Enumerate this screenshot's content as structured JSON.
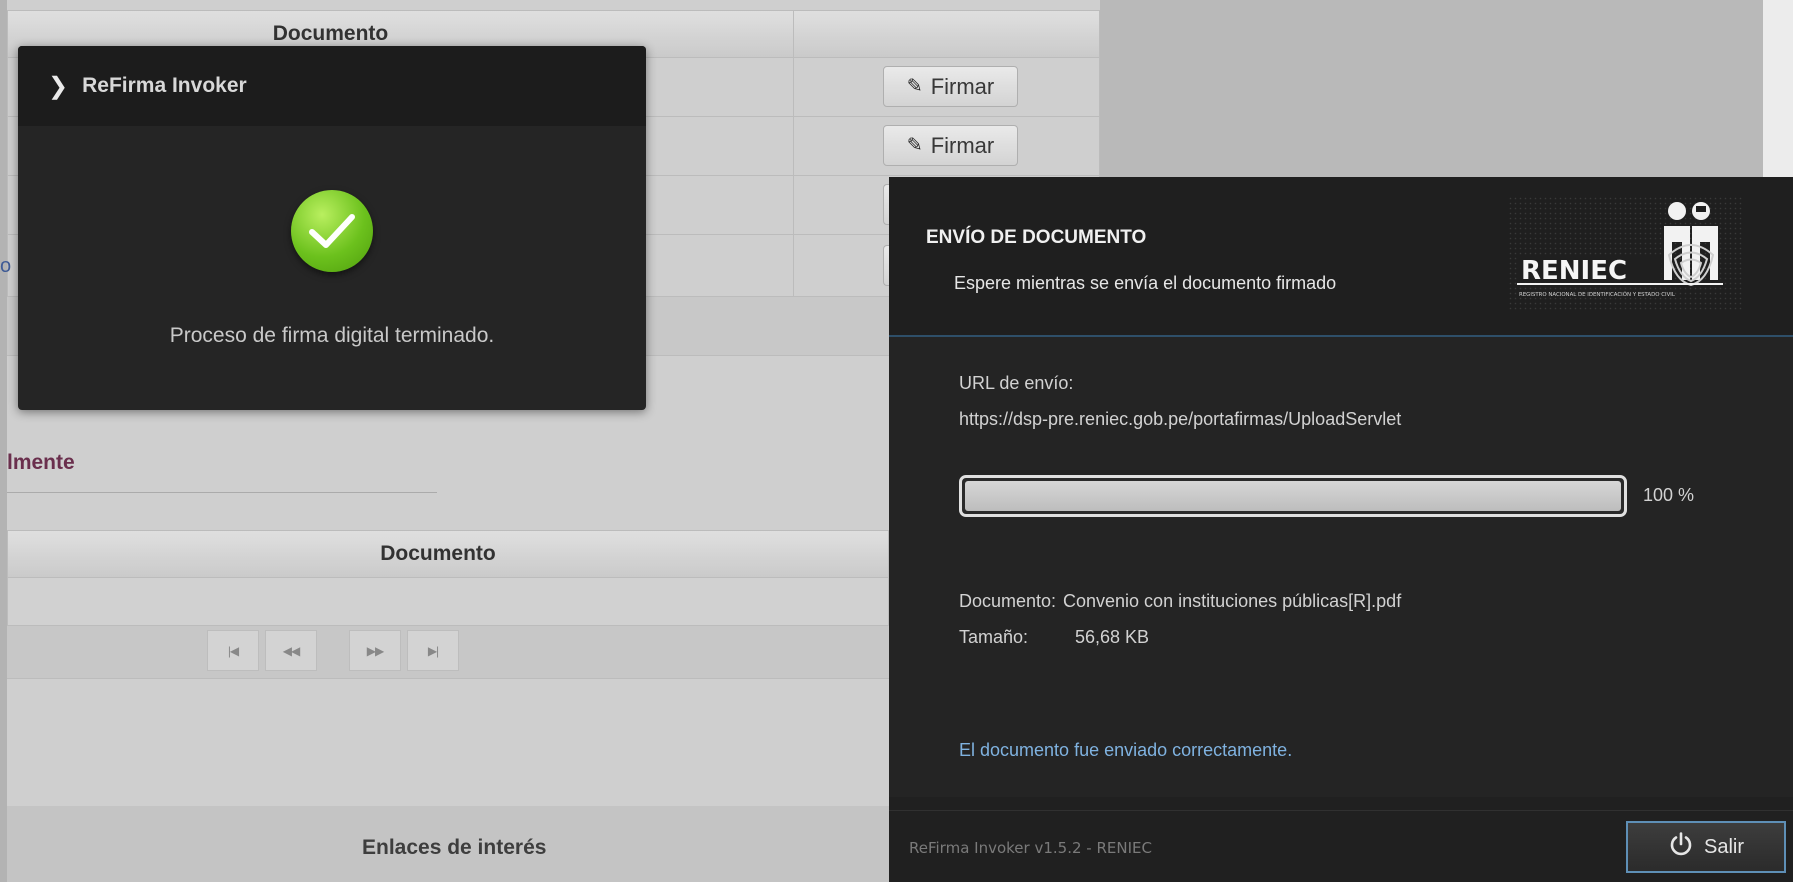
{
  "background_page": {
    "table1": {
      "header_documento": "Documento",
      "rows": [
        {
          "action_label": "Firmar"
        },
        {
          "action_label": "Firmar"
        }
      ]
    },
    "left_truncated_link": "o",
    "section_heading_partial": "lmente",
    "table2": {
      "header_documento": "Documento"
    },
    "pager_icons": [
      "first-page-icon",
      "previous-page-icon",
      "next-page-icon",
      "last-page-icon"
    ],
    "footer_heading": "Enlaces de interés"
  },
  "toast": {
    "title": "ReFirma Invoker",
    "message": "Proceso de firma digital terminado.",
    "icon": "success-check-icon",
    "colors": {
      "check": "#6cc11d"
    }
  },
  "dialog": {
    "title": "ENVÍO DE DOCUMENTO",
    "subtitle": "Espere mientras se envía el documento firmado",
    "logo": {
      "wordmark": "RENIEC",
      "tagline": "REGISTRO NACIONAL DE IDENTIFICACIÓN Y ESTADO CIVIL"
    },
    "url_label": "URL de envío:",
    "url_value": "https://dsp-pre.reniec.gob.pe/portafirmas/UploadServlet",
    "progress": {
      "value_percent": 100,
      "label": "100 %"
    },
    "document_label": "Documento:",
    "document_value": "Convenio con instituciones públicas[R].pdf",
    "size_label": "Tamaño:",
    "size_value": "56,68 KB",
    "success_message": "El documento fue enviado correctamente.",
    "footer_version": "ReFirma Invoker v1.5.2 - RENIEC",
    "exit_button": {
      "label": "Salir",
      "icon": "power-icon"
    },
    "colors": {
      "accent_border": "#5e8fb6",
      "success_text": "#7fb2e0"
    }
  }
}
